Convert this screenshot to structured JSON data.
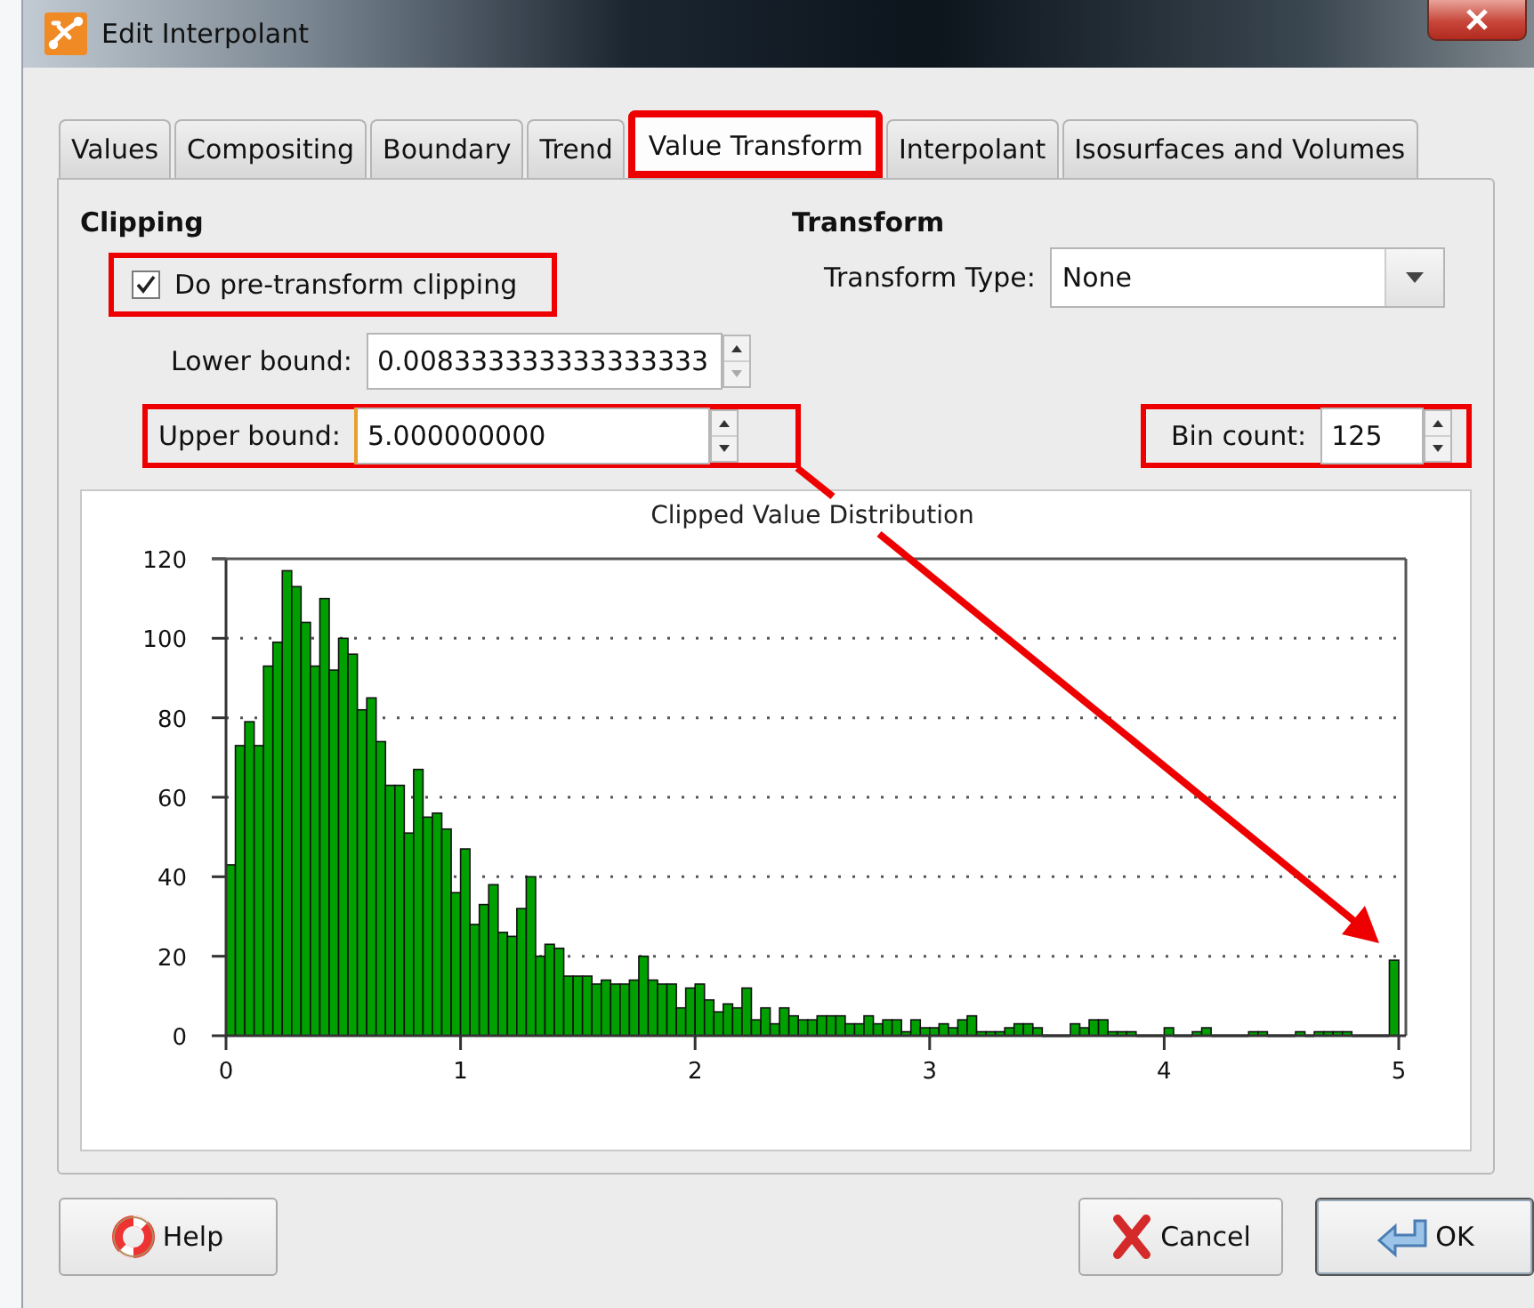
{
  "window": {
    "title": "Edit Interpolant"
  },
  "tabs": [
    {
      "label": "Values",
      "selected": false,
      "highlighted": false
    },
    {
      "label": "Compositing",
      "selected": false,
      "highlighted": false
    },
    {
      "label": "Boundary",
      "selected": false,
      "highlighted": false
    },
    {
      "label": "Trend",
      "selected": false,
      "highlighted": false
    },
    {
      "label": "Value Transform",
      "selected": true,
      "highlighted": true
    },
    {
      "label": "Interpolant",
      "selected": false,
      "highlighted": false
    },
    {
      "label": "Isosurfaces and Volumes",
      "selected": false,
      "highlighted": false
    }
  ],
  "clipping": {
    "heading": "Clipping",
    "pre_clip": {
      "label": "Do pre-transform clipping",
      "checked": true,
      "highlighted": true
    },
    "lower": {
      "label": "Lower bound:",
      "value": "0.008333333333333333",
      "highlighted": false
    },
    "upper": {
      "label": "Upper bound:",
      "value": "5.000000000",
      "highlighted": true
    }
  },
  "transform": {
    "heading": "Transform",
    "type_label": "Transform Type:",
    "type_value": "None",
    "bin_count": {
      "label": "Bin count:",
      "value": "125",
      "highlighted": true
    }
  },
  "chart": {
    "chart_data": {
      "type": "bar",
      "title": "Clipped Value Distribution",
      "grid": true,
      "xlim": [
        0,
        5
      ],
      "x": [
        0.02,
        0.06,
        0.1,
        0.14,
        0.18,
        0.22,
        0.26,
        0.3,
        0.34,
        0.38,
        0.42,
        0.46,
        0.5,
        0.54,
        0.58,
        0.62,
        0.66,
        0.7,
        0.74,
        0.78,
        0.82,
        0.86,
        0.9,
        0.94,
        0.98,
        1.02,
        1.06,
        1.1,
        1.14,
        1.18,
        1.22,
        1.26,
        1.3,
        1.34,
        1.38,
        1.42,
        1.46,
        1.5,
        1.54,
        1.58,
        1.62,
        1.66,
        1.7,
        1.74,
        1.78,
        1.82,
        1.86,
        1.9,
        1.94,
        1.98,
        2.02,
        2.06,
        2.1,
        2.14,
        2.18,
        2.22,
        2.26,
        2.3,
        2.34,
        2.38,
        2.42,
        2.46,
        2.5,
        2.54,
        2.58,
        2.62,
        2.66,
        2.7,
        2.74,
        2.78,
        2.82,
        2.86,
        2.9,
        2.94,
        2.98,
        3.02,
        3.06,
        3.1,
        3.14,
        3.18,
        3.22,
        3.26,
        3.3,
        3.34,
        3.38,
        3.42,
        3.46,
        3.5,
        3.54,
        3.58,
        3.62,
        3.66,
        3.7,
        3.74,
        3.78,
        3.82,
        3.86,
        3.9,
        3.94,
        3.98,
        4.02,
        4.06,
        4.1,
        4.14,
        4.18,
        4.22,
        4.26,
        4.3,
        4.34,
        4.38,
        4.42,
        4.46,
        4.5,
        4.54,
        4.58,
        4.62,
        4.66,
        4.7,
        4.74,
        4.78,
        4.82,
        4.86,
        4.9,
        4.94,
        4.98
      ],
      "ylim": [
        0,
        120
      ],
      "xticks": [
        0,
        1,
        2,
        3,
        4,
        5
      ],
      "yticks": [
        0,
        20,
        40,
        60,
        80,
        100,
        120
      ],
      "values": [
        43,
        73,
        79,
        73,
        93,
        99,
        117,
        113,
        104,
        93,
        110,
        92,
        100,
        96,
        82,
        85,
        74,
        63,
        63,
        51,
        67,
        55,
        56,
        52,
        36,
        47,
        28,
        33,
        38,
        26,
        25,
        32,
        40,
        20,
        23,
        22,
        15,
        15,
        15,
        13,
        14,
        13,
        13,
        14,
        20,
        14,
        13,
        13,
        7,
        12,
        13,
        9,
        6,
        8,
        7,
        12,
        4,
        7,
        3,
        7,
        5,
        4,
        4,
        5,
        5,
        5,
        3,
        3,
        5,
        3,
        4,
        4,
        1,
        4,
        2,
        2,
        3,
        2,
        4,
        5,
        1,
        1,
        1,
        2,
        3,
        3,
        2,
        0,
        0,
        0,
        3,
        2,
        4,
        4,
        1,
        1,
        1,
        0,
        0,
        0,
        2,
        0,
        0,
        1,
        2,
        0,
        0,
        0,
        0,
        1,
        1,
        0,
        0,
        0,
        1,
        0,
        1,
        1,
        1,
        1,
        0,
        0,
        0,
        0,
        19
      ]
    }
  },
  "annotation_arrow": {
    "shown": true
  },
  "buttons": [
    {
      "label": "Help",
      "kind": "help",
      "default": false
    },
    {
      "label": "Cancel",
      "kind": "cancel",
      "default": false
    },
    {
      "label": "OK",
      "kind": "ok",
      "default": true
    }
  ]
}
